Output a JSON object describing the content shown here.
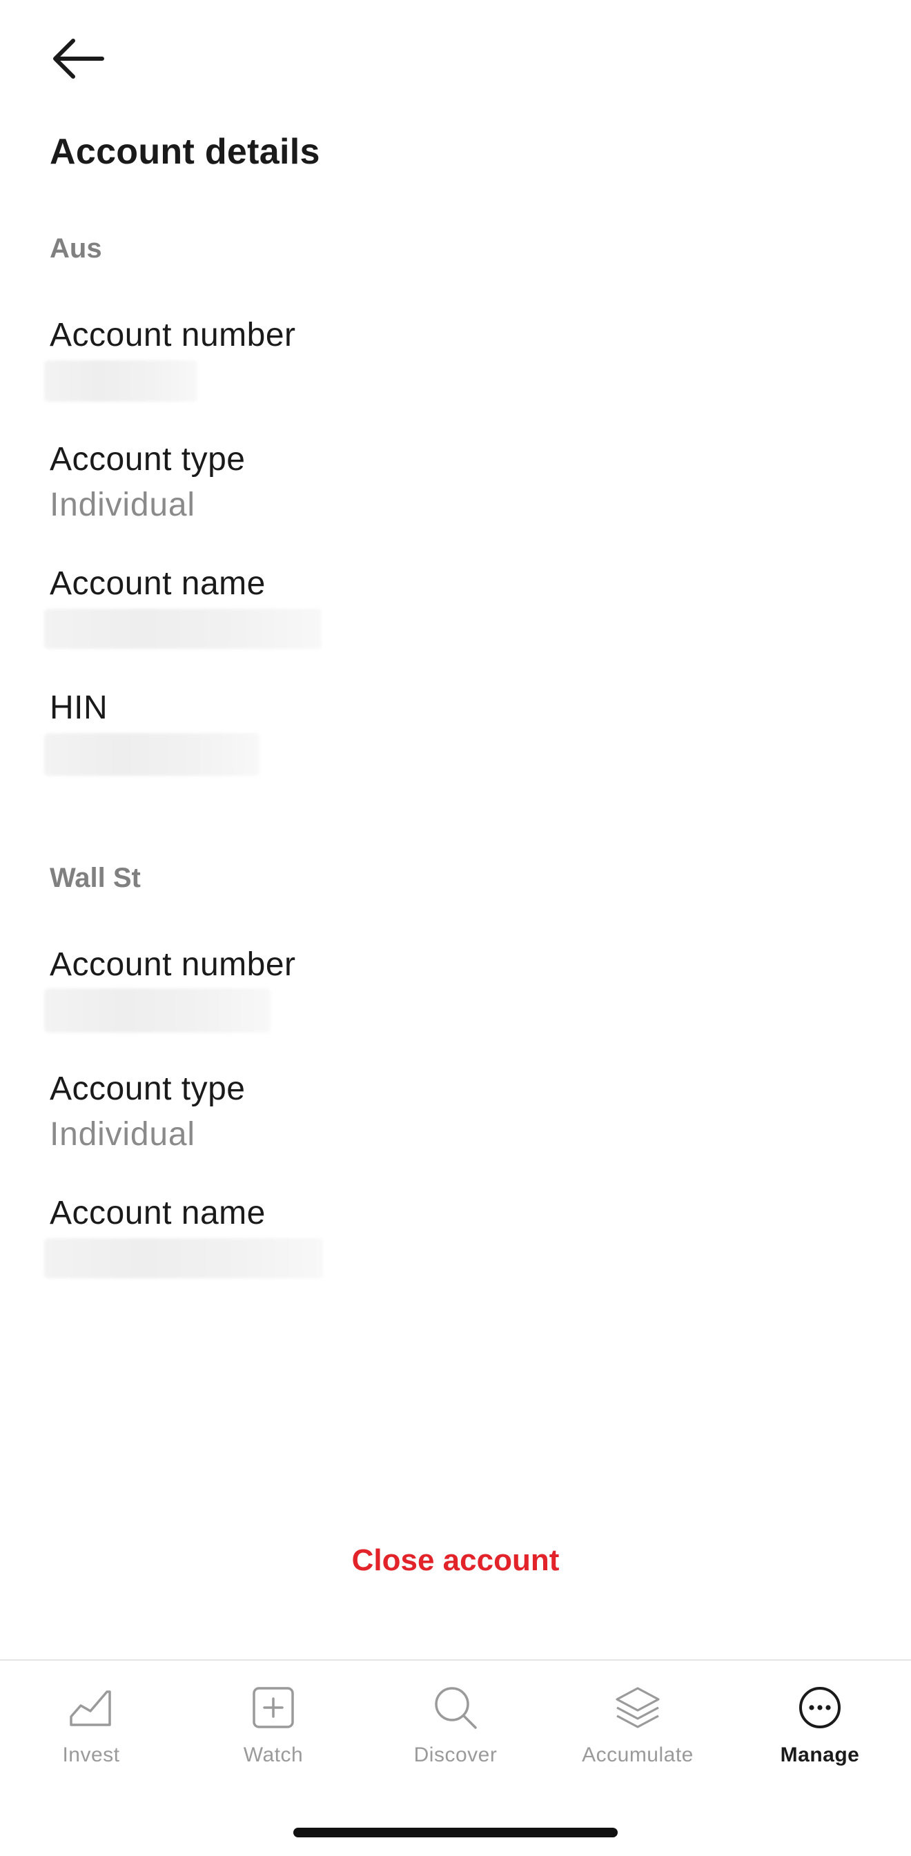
{
  "header": {
    "back_icon": "arrow-left-icon",
    "title": "Account details"
  },
  "sections": [
    {
      "heading": "Aus",
      "fields": [
        {
          "label": "Account number",
          "value": ""
        },
        {
          "label": "Account type",
          "value": "Individual"
        },
        {
          "label": "Account name",
          "value": ""
        },
        {
          "label": "HIN",
          "value": ""
        }
      ]
    },
    {
      "heading": "Wall St",
      "fields": [
        {
          "label": "Account number",
          "value": ""
        },
        {
          "label": "Account type",
          "value": "Individual"
        },
        {
          "label": "Account name",
          "value": ""
        }
      ]
    }
  ],
  "actions": {
    "close_account_label": "Close account"
  },
  "tabs": [
    {
      "label": "Invest",
      "icon": "line-chart-icon",
      "active": false
    },
    {
      "label": "Watch",
      "icon": "plus-square-icon",
      "active": false
    },
    {
      "label": "Discover",
      "icon": "search-icon",
      "active": false
    },
    {
      "label": "Accumulate",
      "icon": "layers-icon",
      "active": false
    },
    {
      "label": "Manage",
      "icon": "more-circle-icon",
      "active": true
    }
  ],
  "colors": {
    "accent_red": "#e2232a",
    "muted_text": "#8a8a8a",
    "heading_gray": "#808080",
    "inactive_tab": "#9a9a9a"
  }
}
